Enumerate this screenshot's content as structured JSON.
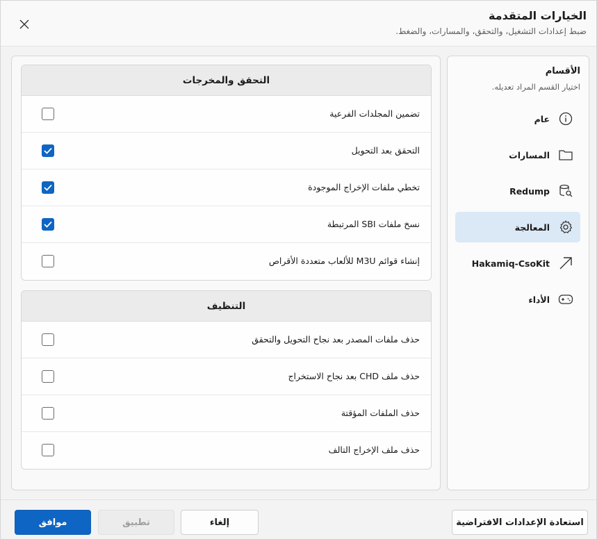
{
  "window": {
    "title": "الخيارات المتقدمة",
    "subtitle": "ضبط إعدادات التشغيل، والتحقق، والمسارات، والضغط."
  },
  "sidebar": {
    "title": "الأقسام",
    "subtitle": "اختيار القسم المراد تعديله.",
    "items": [
      {
        "label": "عام",
        "icon": "info-icon",
        "active": false
      },
      {
        "label": "المسارات",
        "icon": "folder-icon",
        "active": false
      },
      {
        "label": "Redump",
        "icon": "database-search-icon",
        "active": false
      },
      {
        "label": "المعالجة",
        "icon": "gear-icon",
        "active": true
      },
      {
        "label": "Hakamiq-CsoKit",
        "icon": "arrow-up-right-icon",
        "active": false
      },
      {
        "label": "الأداء",
        "icon": "gamepad-icon",
        "active": false
      }
    ]
  },
  "groups": [
    {
      "title": "التحقق والمخرجات",
      "options": [
        {
          "label": "تضمين المجلدات الفرعية",
          "checked": false
        },
        {
          "label": "التحقق بعد التحويل",
          "checked": true
        },
        {
          "label": "تخطي ملفات الإخراج الموجودة",
          "checked": true
        },
        {
          "label": "نسخ ملفات SBI المرتبطة",
          "checked": true
        },
        {
          "label": "إنشاء قوائم M3U للألعاب متعددة الأقراص",
          "checked": false
        }
      ]
    },
    {
      "title": "التنظيف",
      "options": [
        {
          "label": "حذف ملفات المصدر بعد نجاح التحويل والتحقق",
          "checked": false
        },
        {
          "label": "حذف ملف CHD بعد نجاح الاستخراج",
          "checked": false
        },
        {
          "label": "حذف الملفات المؤقتة",
          "checked": false
        },
        {
          "label": "حذف ملف الإخراج التالف",
          "checked": false
        }
      ]
    }
  ],
  "footer": {
    "restore_label": "استعادة الإعدادات الافتراضية",
    "cancel_label": "إلغاء",
    "apply_label": "تطبيق",
    "ok_label": "موافق"
  },
  "colors": {
    "accent": "#0f65c3",
    "active_nav": "#dbe8f5"
  }
}
